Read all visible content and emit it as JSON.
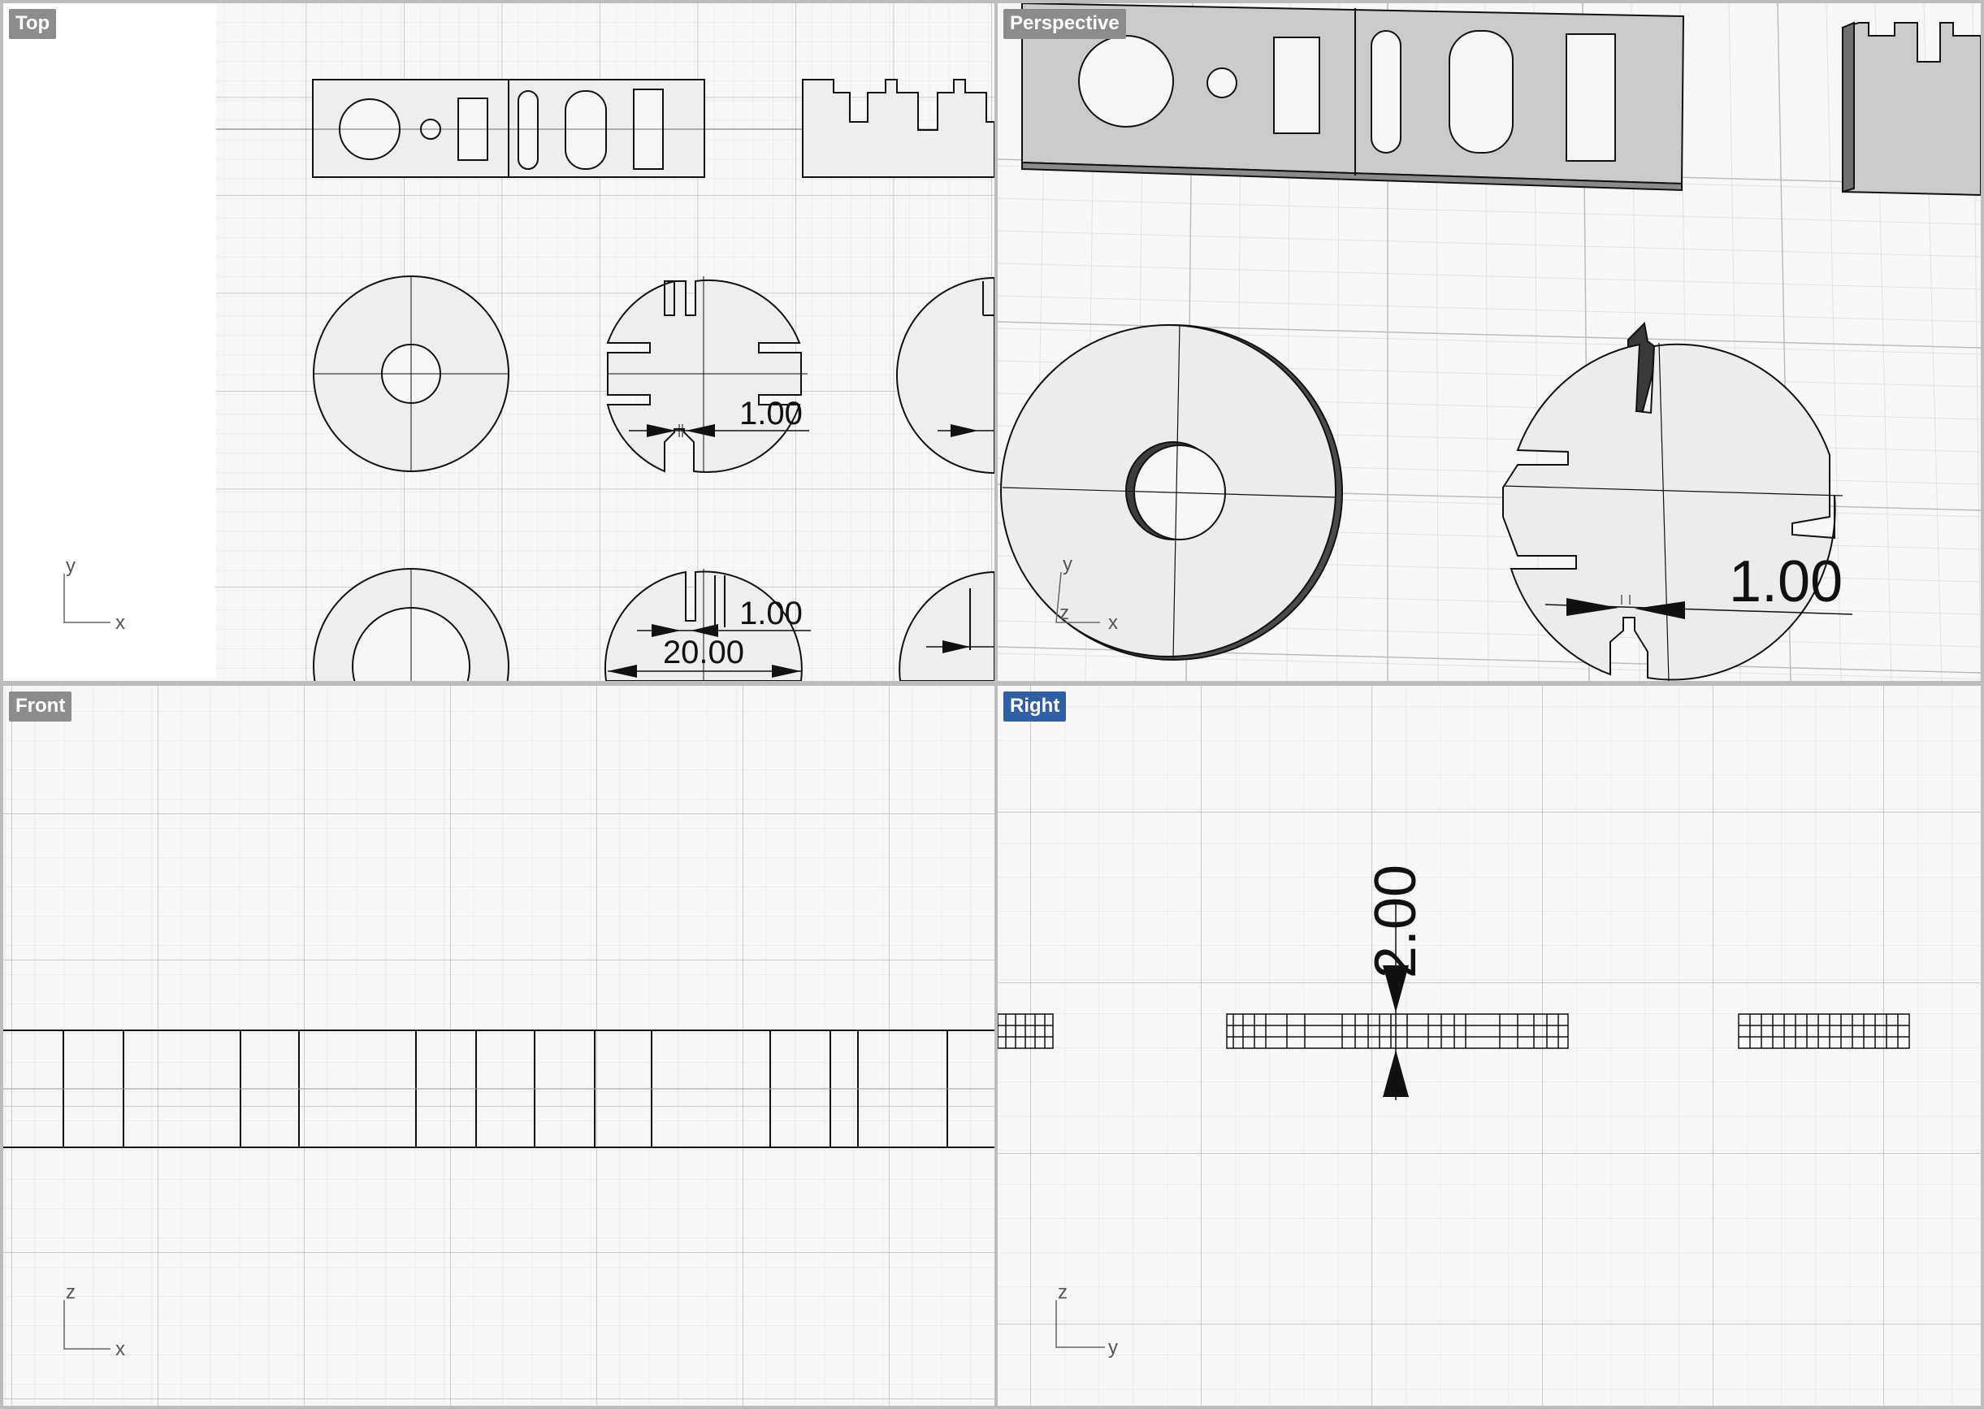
{
  "viewports": {
    "top": {
      "label": "Top",
      "axis_h": "x",
      "axis_v": "y",
      "dims": [
        "1.00",
        "1.00",
        "20.00"
      ]
    },
    "perspective": {
      "label": "Perspective",
      "axis_h": "x",
      "axis_v": "y",
      "axis_z": "z",
      "dims": [
        "1.00"
      ]
    },
    "front": {
      "label": "Front",
      "axis_h": "x",
      "axis_v": "z"
    },
    "right": {
      "label": "Right",
      "axis_h": "y",
      "axis_v": "z",
      "dims": [
        "2.00"
      ],
      "active": true
    }
  },
  "colors": {
    "viewport_bg": "#f7f7f7",
    "grid_minor": "#e3e3e3",
    "grid_major": "#bcbcbc",
    "part_fill": "#eeeeee",
    "part_fill_3d": "#cfcfcf",
    "edge": "#111111",
    "active_label": "#2f5fa5",
    "inactive_label": "#8c8c8c"
  }
}
